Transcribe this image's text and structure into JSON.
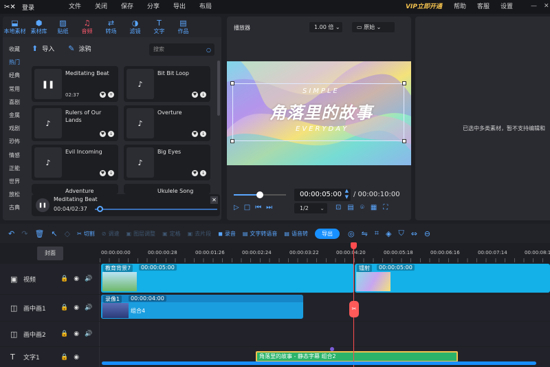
{
  "app": {
    "logo_text": "✂✕",
    "login_label": "登录",
    "menu": [
      "文件",
      "关闭",
      "保存",
      "分享",
      "导出",
      "布局"
    ],
    "vip_label": "VIP立即开通",
    "right_menu": [
      "帮助",
      "客服",
      "设置"
    ],
    "window_buttons": [
      "—",
      "✕"
    ]
  },
  "library": {
    "tabs": [
      {
        "label": "本地素材",
        "icon": "⬓"
      },
      {
        "label": "素材库",
        "icon": "⬢"
      },
      {
        "label": "贴纸",
        "icon": "▨"
      },
      {
        "label": "音频",
        "icon": "♫"
      },
      {
        "label": "转场",
        "icon": "⇄"
      },
      {
        "label": "滤镜",
        "icon": "◑"
      },
      {
        "label": "文字",
        "icon": "T"
      },
      {
        "label": "作品",
        "icon": "▤"
      }
    ],
    "categories": [
      "收藏",
      "热门",
      "经典",
      "常用",
      "喜剧",
      "金属",
      "戏剧",
      "恐怖",
      "情感",
      "正能",
      "世界",
      "放松",
      "古典"
    ],
    "import_label": "导入",
    "doodle_label": "涂鸦",
    "search_placeholder": "搜索",
    "tracks": [
      {
        "title": "Meditating Beat",
        "duration": "02:37",
        "state": "pause"
      },
      {
        "title": "Bit Bit Loop",
        "duration": "",
        "state": "note"
      },
      {
        "title": "Rulers of Our Lands",
        "duration": "",
        "state": "note"
      },
      {
        "title": "Overture",
        "duration": "",
        "state": "note"
      },
      {
        "title": "Evil Incoming",
        "duration": "",
        "state": "note"
      },
      {
        "title": "Big Eyes",
        "duration": "",
        "state": "note"
      },
      {
        "title": "Adventure",
        "duration": "",
        "state": "note"
      },
      {
        "title": "Ukulele Song",
        "duration": "",
        "state": "note"
      }
    ],
    "now_playing": {
      "title": "Meditating Beat",
      "time": "00:04/02:37",
      "progress": 0.03
    }
  },
  "player": {
    "title": "播放器",
    "zoom": "1.00 倍",
    "ratio": "原始",
    "overlay_top": "SIMPLE",
    "overlay_main": "角落里的故事",
    "overlay_bottom": "EVERYDAY",
    "current_time": "00:00:05:00",
    "total_time": "/ 00:00:10:00",
    "fraction": "1/2",
    "volume": 0.5
  },
  "properties": {
    "message": "已选中多类素材，暂不支持编辑和"
  },
  "toolbar": {
    "cut": "切割",
    "record": "录音",
    "tts": "文字转语音",
    "voice": "语音转",
    "export": "导出",
    "disabled": [
      "调速",
      "图层调整",
      "定格",
      "去片段"
    ]
  },
  "timeline": {
    "cover_label": "封面",
    "ruler": [
      "00:00:00:00",
      "00:00:00:28",
      "00:00:01:26",
      "00:00:02:24",
      "00:00:03:22",
      "00:00:04:20",
      "00:00:05:18",
      "00:00:06:16",
      "00:00:07:14",
      "00:00:08:1"
    ],
    "tracks": [
      {
        "name": "视频",
        "icon": "▣"
      },
      {
        "name": "画中画1",
        "icon": "◫"
      },
      {
        "name": "画中画2",
        "icon": "◫"
      },
      {
        "name": "文字1",
        "icon": "T"
      }
    ],
    "clips": {
      "video1_label": "教育背景7",
      "video1_dur": "00:00:05:00",
      "video2_label": "镭射",
      "video2_dur": "00:00:05:00",
      "pip_label": "录像1",
      "pip_dur": "00:00:04:00",
      "pip_group": "组合4",
      "text_clip": "角落里的故事 - 静态字幕  组合2"
    }
  }
}
